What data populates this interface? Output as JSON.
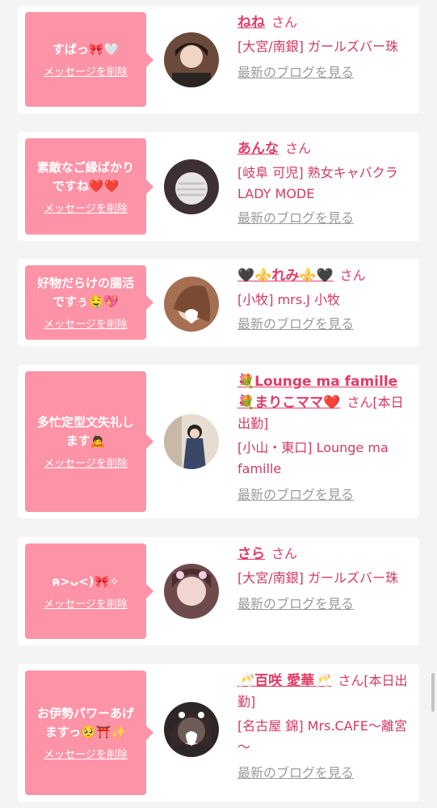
{
  "delete_label": "メッセージを削除",
  "blog_label": "最新のブログを見る",
  "honorific": "さん",
  "entries": [
    {
      "message": "すばっ🎀🤍",
      "name": "ねね",
      "shop": "[大宮/南銀] ガールズバー珠"
    },
    {
      "message": "素敵なご縁ばかりですね❤️❤️",
      "name": "あんな",
      "shop": "[岐阜 可児] 熟女キャバクラ LADY MODE"
    },
    {
      "message": "好物だらけの腸活ですぅ🤤💖",
      "name": "🖤⚜️れみ⚜️🖤",
      "shop": "[小牧] mrs.J 小牧"
    },
    {
      "message": "多忙定型文失礼します🙇",
      "name": "💐Lounge ma famille💐まりこママ❤️",
      "shop": "[小山・東口] Lounge ma famille",
      "extra": "[本日出勤]"
    },
    {
      "message": "ฅ>ᴗ<)🎀✧",
      "name": "さら",
      "shop": "[大宮/南銀] ガールズバー珠"
    },
    {
      "message": "お伊勢パワーあげますっ🥺⛩️✨",
      "name": "🥂百咲 愛華🥂",
      "shop": "[名古屋 錦] Mrs.CAFE～離宮～",
      "extra": "[本日出勤]"
    }
  ]
}
